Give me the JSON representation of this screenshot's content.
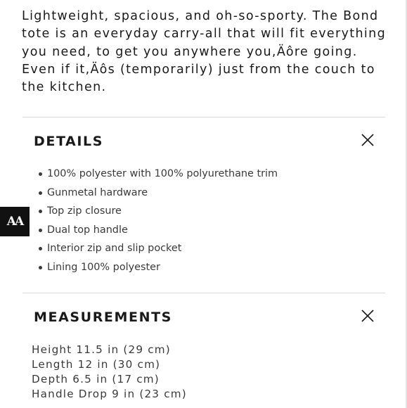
{
  "intro_text": "Lightweight, spacious, and oh-so-sporty. The Bond tote is an everyday carry-all that will fit everything you need, to get you anywhere you,Äôre going. Even if it,Äôs (temporarily) just from the couch to the kitchen.",
  "accessibility_badge": "AA",
  "details": {
    "title": "DETAILS",
    "close_icon": "close-icon",
    "items": [
      "100% polyester with 100% polyurethane trim",
      "Gunmetal hardware",
      "Top zip closure",
      "Dual top handle",
      "Interior zip and slip pocket",
      "Lining 100% polyester"
    ]
  },
  "measurements": {
    "title": "MEASUREMENTS",
    "close_icon": "close-icon",
    "items": [
      "Height 11.5 in (29 cm)",
      "Length 12 in (30 cm)",
      "Depth 6.5 in (17 cm)",
      "Handle Drop 9 in (23 cm)"
    ]
  },
  "colors": {
    "text": "#1a1a1a",
    "muted_text": "#3a3a3a",
    "divider": "#d9d9d9",
    "badge_bg": "#111111"
  }
}
